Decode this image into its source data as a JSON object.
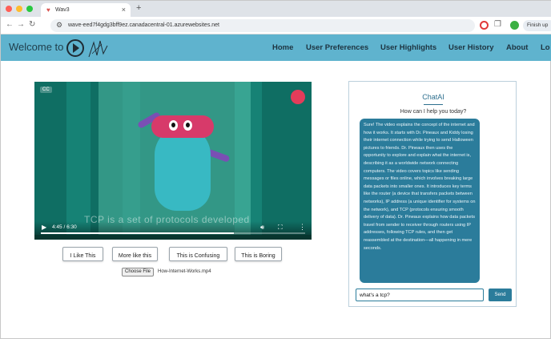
{
  "browser": {
    "tab_title": "Wav3",
    "url": "wave-eed7f4gdg3bff9ez.canadacentral-01.azurewebsites.net",
    "finish_label": "Finish up",
    "colors": {
      "close": "#ff5f57",
      "minimize": "#febc2e",
      "maximize": "#28c840"
    }
  },
  "nav": {
    "brand": "Welcome to",
    "links": [
      "Home",
      "User Preferences",
      "User Highlights",
      "User History",
      "About",
      "Lo"
    ],
    "color": "#5fb3ce"
  },
  "video": {
    "time": "4:45 / 6:30",
    "subtitle": "TCP is a set of protocols developed",
    "progress": 0.73,
    "quality_badge": "CC"
  },
  "feedback": {
    "buttons": [
      "I Like This",
      "More like this",
      "This is Confusing",
      "This is Boring"
    ]
  },
  "file": {
    "choose_label": "Choose File",
    "filename": "How-Internet-Works.mp4"
  },
  "chat": {
    "title": "ChatAI",
    "greeting": "How can I help you today?",
    "response": "Sure! The video explains the concept of the internet and how it works. It starts with Dr. Pineaux and Kiddy losing their internet connection while trying to send Halloween pictures to friends. Dr. Pineaux then uses the opportunity to explore and explain what the internet is, describing it as a worldwide network connecting computers. The video covers topics like sending messages or files online, which involves breaking large data packets into smaller ones. It introduces key terms like the router (a device that transfers packets between networks), IP address (a unique identifier for systems on the network), and TCP (protocols ensuring smooth delivery of data). Dr. Pineaux explains how data packets travel from sender to receiver through routers using IP addresses, following TCP rules, and then get reassembled at the destination—all happening in mere seconds.",
    "input_value": "what's a tcp?",
    "send_label": "Send"
  }
}
